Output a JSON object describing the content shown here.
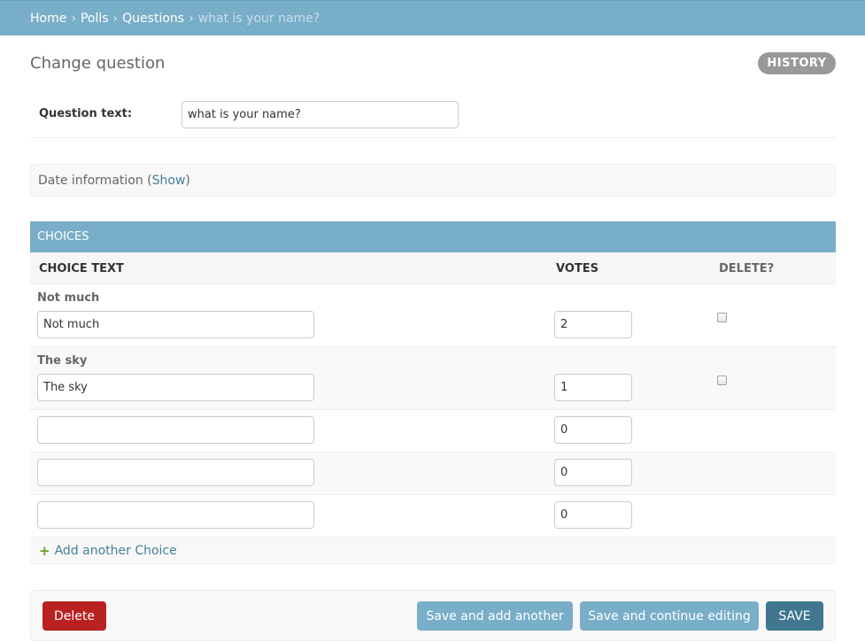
{
  "breadcrumbs": {
    "home": "Home",
    "polls": "Polls",
    "questions": "Questions",
    "current": "what is your name?",
    "separator": "›"
  },
  "page": {
    "title": "Change question",
    "history_label": "HISTORY"
  },
  "question_field": {
    "label": "Question text:",
    "value": "what is your name?"
  },
  "date_fieldset": {
    "label": "Date information (",
    "show_link": "Show",
    "close_paren": ")"
  },
  "choices": {
    "header": "CHOICES",
    "columns": {
      "choice_text": "CHOICE TEXT",
      "votes": "VOTES",
      "delete": "DELETE?"
    },
    "rows": [
      {
        "original": "Not much",
        "text": "Not much",
        "votes": "2",
        "delete_checked": false
      },
      {
        "original": "The sky",
        "text": "The sky",
        "votes": "1",
        "delete_checked": false
      },
      {
        "original": "",
        "text": "",
        "votes": "0"
      },
      {
        "original": "",
        "text": "",
        "votes": "0"
      },
      {
        "original": "",
        "text": "",
        "votes": "0"
      }
    ],
    "add_another": "Add another Choice",
    "add_icon": "plus-icon"
  },
  "submit": {
    "delete": "Delete",
    "save_add_another": "Save and add another",
    "save_continue": "Save and continue editing",
    "save": "SAVE"
  },
  "colors": {
    "header_blue": "#79aec8",
    "link_blue": "#447e9b",
    "save_dark": "#417690",
    "delete_red": "#ba2121",
    "add_green": "#5fa225"
  }
}
